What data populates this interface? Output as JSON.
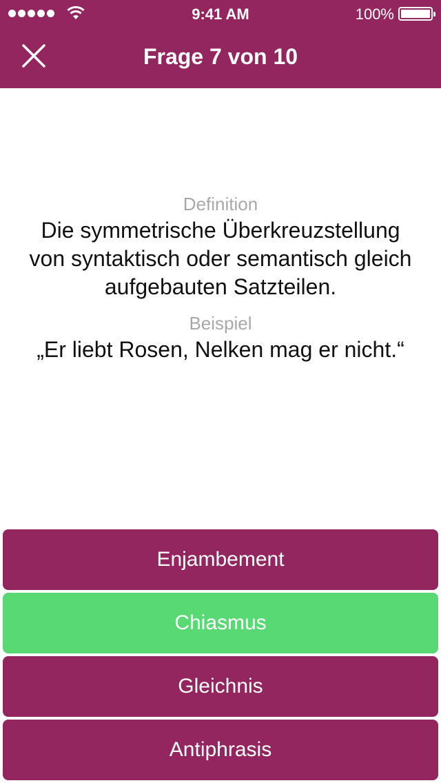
{
  "status_bar": {
    "time": "9:41 AM",
    "battery_percent": "100%",
    "battery_level": 1.0,
    "signal_dots": 5
  },
  "nav": {
    "title": "Frage 7 von 10",
    "close_icon": "close-icon"
  },
  "question": {
    "definition_label": "Definition",
    "definition_text": "Die symmetrische Überkreuzstellung von syntaktisch oder semantisch gleich aufgebauten Satzteilen.",
    "example_label": "Beispiel",
    "example_text": "„Er liebt Rosen, Nelken mag er nicht.“"
  },
  "answers": [
    {
      "label": "Enjambement",
      "state": "default"
    },
    {
      "label": "Chiasmus",
      "state": "correct"
    },
    {
      "label": "Gleichnis",
      "state": "default"
    },
    {
      "label": "Antiphrasis",
      "state": "default"
    }
  ],
  "colors": {
    "brand": "#93265f",
    "correct": "#58d974",
    "label_gray": "#a8a8a8"
  }
}
